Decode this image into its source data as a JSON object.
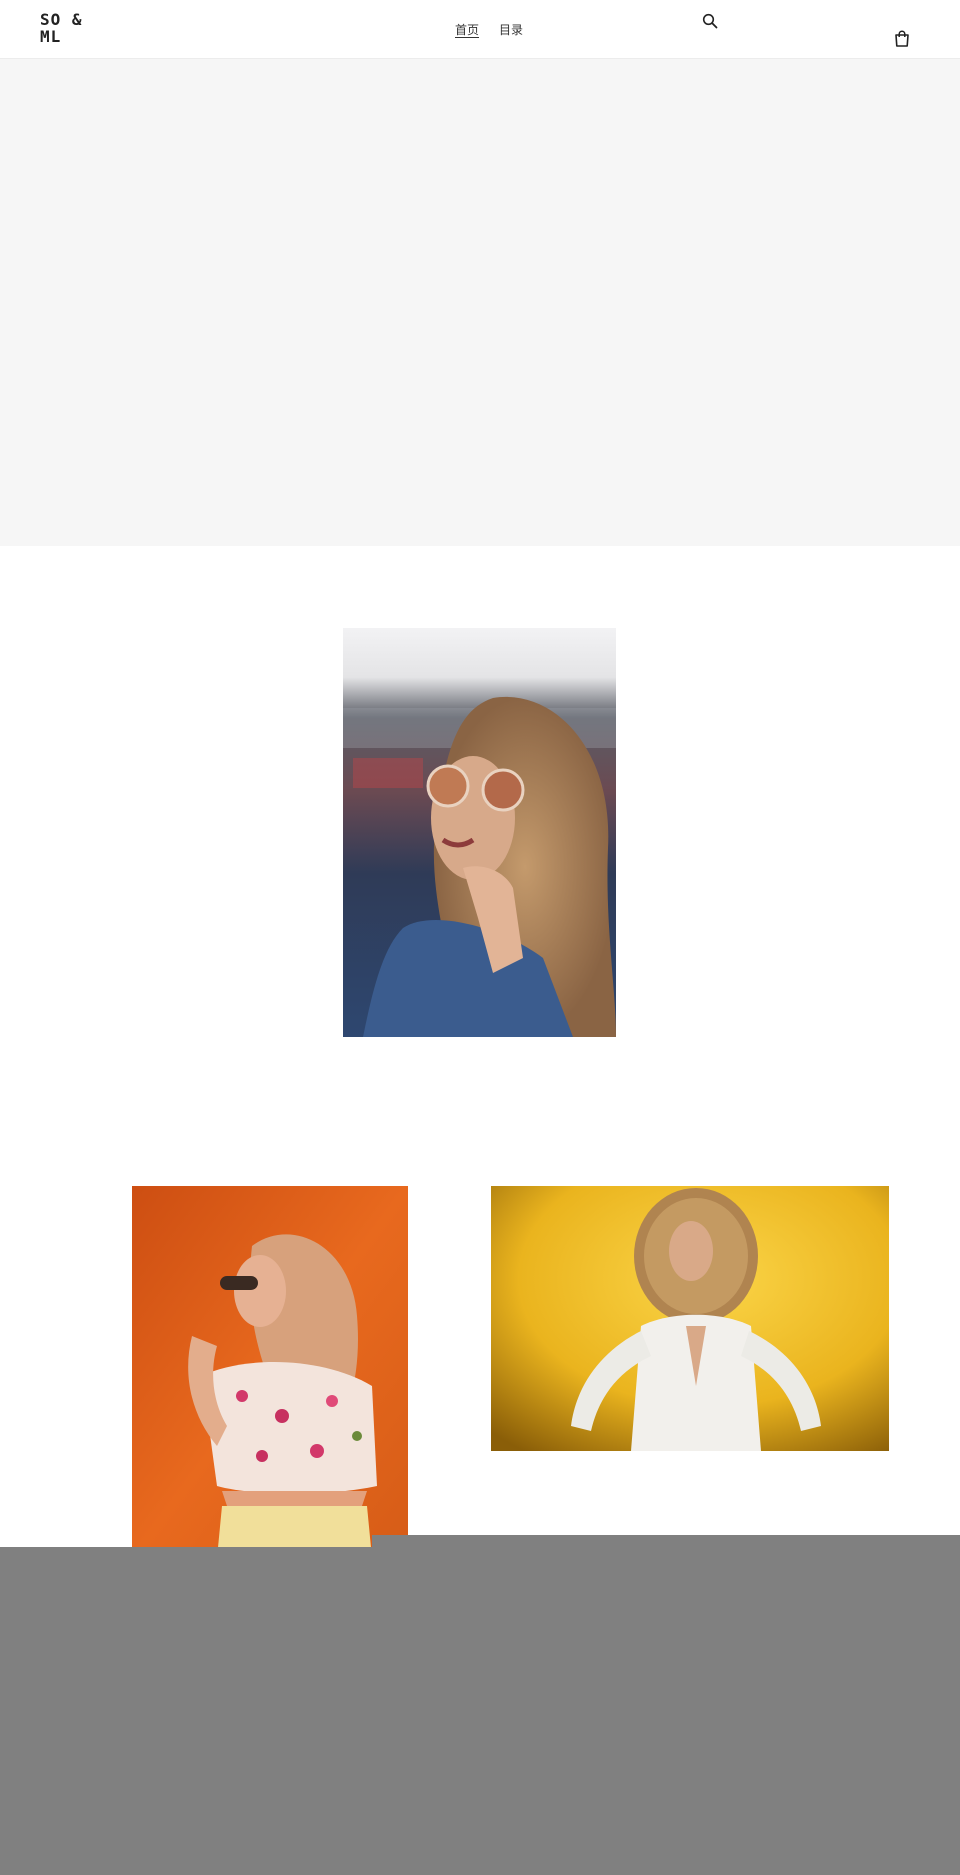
{
  "header": {
    "logo": "SO & ML",
    "nav": [
      {
        "label": "首页",
        "active": true
      },
      {
        "label": "目录",
        "active": false
      }
    ],
    "search_icon": "search-icon",
    "cart_icon": "shopping-bag-icon"
  },
  "images": {
    "featured": "woman-with-sunglasses-photo",
    "left": "woman-in-floral-top-orange-background-photo",
    "right": "curly-haired-woman-yellow-background-photo"
  },
  "colors": {
    "hero_placeholder": "#f6f6f6",
    "overlay": "#808080"
  }
}
